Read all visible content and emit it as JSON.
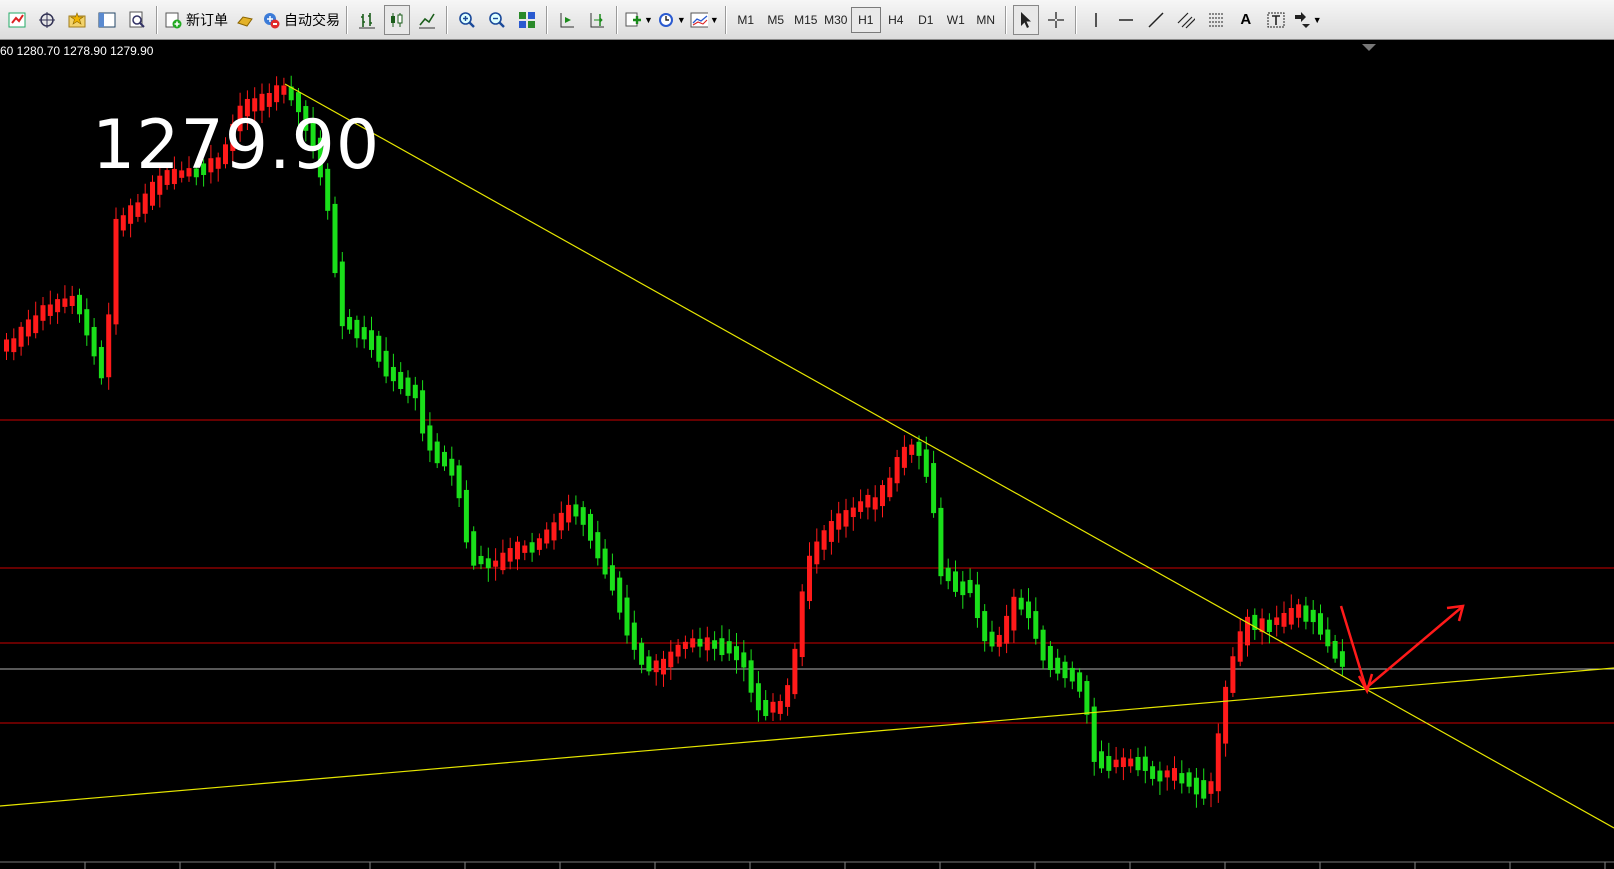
{
  "toolbar": {
    "new_order_label": "新订单",
    "auto_trade_label": "自动交易",
    "timeframes": [
      "M1",
      "M5",
      "M15",
      "M30",
      "H1",
      "H4",
      "D1",
      "W1",
      "MN"
    ],
    "active_timeframe": "H1",
    "text_tool_label": "A"
  },
  "chart": {
    "ohlc_readout": "60 1280.70 1278.90 1279.90",
    "last_price_display": "1279.90"
  },
  "colors": {
    "background": "#000000",
    "bull_candle": "#ff1a1a",
    "bear_candle": "#1adf1a",
    "trendline": "#e6e600",
    "level_line": "#cc0000",
    "current_price_line": "#b0b0b0",
    "arrow": "#ff1a1a"
  }
}
